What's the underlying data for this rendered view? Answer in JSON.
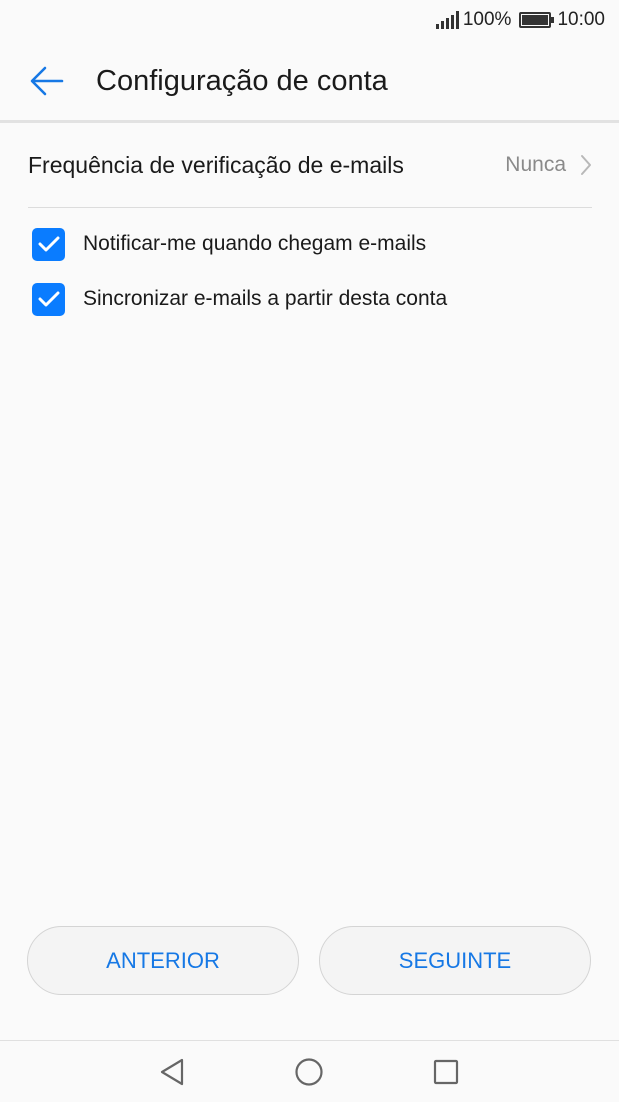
{
  "status_bar": {
    "battery_percent": "100%",
    "time": "10:00"
  },
  "header": {
    "title": "Configuração de conta",
    "back_icon": "arrow-left-icon",
    "accent_color": "#1678e5"
  },
  "settings": {
    "frequency": {
      "label": "Frequência de verificação de e-mails",
      "value": "Nunca"
    },
    "checkboxes": [
      {
        "label": "Notificar-me quando chegam e-mails",
        "checked": true
      },
      {
        "label": "Sincronizar e-mails a partir desta conta",
        "checked": true
      }
    ],
    "checkbox_color": "#0a7cff"
  },
  "buttons": {
    "previous": "ANTERIOR",
    "next": "SEGUINTE"
  },
  "nav_bar": {
    "icons": [
      "back-triangle-icon",
      "home-circle-icon",
      "recent-square-icon"
    ]
  }
}
